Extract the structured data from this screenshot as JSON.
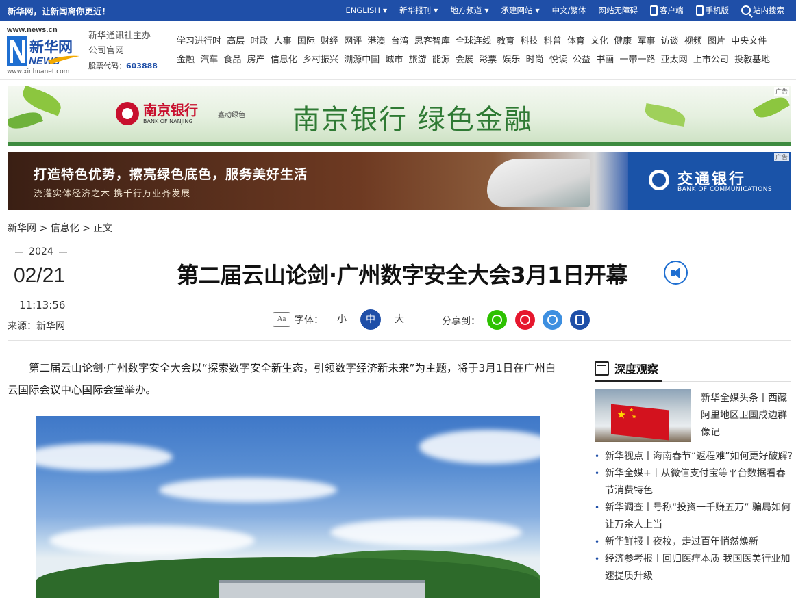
{
  "topbar": {
    "slogan": "新华网，让新闻离你更近！",
    "nav": [
      {
        "label": "ENGLISH",
        "caret": true
      },
      {
        "label": "新华报刊",
        "caret": true
      },
      {
        "label": "地方频道",
        "caret": true
      },
      {
        "label": "承建网站",
        "caret": true
      },
      {
        "label": "中文/繁体",
        "caret": false
      },
      {
        "label": "网站无障碍",
        "caret": false
      }
    ],
    "client_label": "客户端",
    "mobile_label": "手机版",
    "search_label": "站内搜索"
  },
  "header": {
    "logo_url_top": "www.news.cn",
    "logo_url_bottom": "www.xinhuanet.com",
    "logo_text": "新华网",
    "logo_news": "NEWS",
    "corp_line1": "新华通讯社主办",
    "corp_line2": "公司官网",
    "stock_label": "股票代码：",
    "stock_code": "603888",
    "channels_row1": [
      "学习进行时",
      "高层",
      "时政",
      "人事",
      "国际",
      "财经",
      "网评",
      "港澳",
      "台湾",
      "思客智库",
      "全球连线",
      "教育",
      "科技",
      "科普",
      "体育",
      "文化",
      "健康",
      "军事",
      "访谈",
      "视频",
      "图片",
      "中央文件"
    ],
    "channels_row2": [
      "金融",
      "汽车",
      "食品",
      "房产",
      "信息化",
      "乡村振兴",
      "溯源中国",
      "城市",
      "旅游",
      "能源",
      "会展",
      "彩票",
      "娱乐",
      "时尚",
      "悦读",
      "公益",
      "书画",
      "一带一路",
      "亚太网",
      "上市公司",
      "投教基地"
    ]
  },
  "ads": {
    "tag": "广告",
    "ad1": {
      "bank_name": "南京银行",
      "bank_en": "BANK OF NANJING",
      "sub_brand": "鑫动绿色",
      "headline": "南京银行 绿色金融"
    },
    "ad2": {
      "slogan1": "打造特色优势，擦亮绿色底色，服务美好生活",
      "slogan2": "浇灌实体经济之木  携千行万业齐发展",
      "bank_name": "交通银行",
      "bank_en": "BANK OF COMMUNICATIONS"
    }
  },
  "breadcrumb": {
    "items": [
      "新华网",
      "信息化",
      "正文"
    ],
    "separator": ">"
  },
  "article": {
    "year": "2024",
    "month_day": "02/21",
    "time": "11:13:56",
    "source": "来源：新华网",
    "title": "第二届云山论剑·广州数字安全大会3月1日开幕",
    "font_label": "字体：",
    "font_sizes": [
      "小",
      "中",
      "大"
    ],
    "font_selected": "中",
    "share_label": "分享到：",
    "share_targets": [
      "wechat",
      "weibo",
      "link",
      "mobile"
    ],
    "paragraph1": "第二届云山论剑·广州数字安全大会以“探索数字安全新生态，引领数字经济新未来”为主题，将于3月1日在广州白云国际会议中心国际会堂举办。"
  },
  "sidebar": {
    "title": "深度观察",
    "lead": "新华全媒头条丨西藏阿里地区卫国戍边群像记",
    "items": [
      "新华视点丨海南春节“返程难”如何更好破解?",
      "新华全媒+丨从微信支付宝等平台数据看春节消费特色",
      "新华调查丨号称“投资一千赚五万” 骗局如何让万余人上当",
      "新华鲜报丨夜校，走过百年悄然焕新",
      "经济参考报丨回归医疗本质 我国医美行业加速提质升级"
    ]
  },
  "colors": {
    "brand_blue": "#1f4fa8",
    "wechat": "#2dc100",
    "weibo": "#e6162d",
    "link": "#3d8fe0",
    "mobile": "#1f4fa8"
  }
}
